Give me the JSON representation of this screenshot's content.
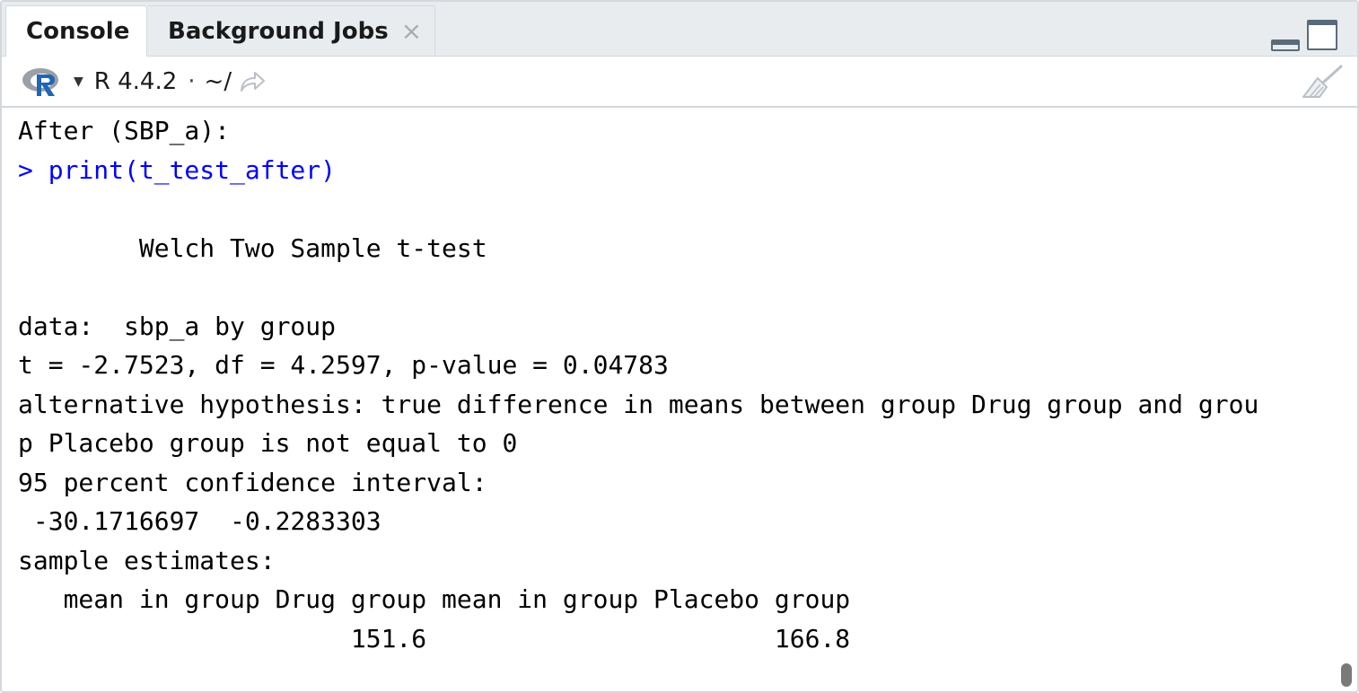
{
  "tabs": [
    {
      "label": "Console",
      "active": true
    },
    {
      "label": "Background Jobs",
      "active": false,
      "close_glyph": "×"
    }
  ],
  "toolbar": {
    "r_version": "R 4.4.2",
    "separator": "·",
    "working_dir": "~/",
    "icons": [
      "r-logo-icon",
      "dropdown-caret-icon",
      "go-to-directory-icon",
      "clear-console-broom-icon"
    ]
  },
  "console": {
    "lines": [
      {
        "text": "After (SBP_a):",
        "kind": "output"
      },
      {
        "text": "> print(t_test_after)",
        "kind": "command"
      },
      {
        "text": "",
        "kind": "output"
      },
      {
        "text": "        Welch Two Sample t-test",
        "kind": "output"
      },
      {
        "text": "",
        "kind": "output"
      },
      {
        "text": "data:  sbp_a by group",
        "kind": "output"
      },
      {
        "text": "t = -2.7523, df = 4.2597, p-value = 0.04783",
        "kind": "output"
      },
      {
        "text": "alternative hypothesis: true difference in means between group Drug group and grou",
        "kind": "output"
      },
      {
        "text": "p Placebo group is not equal to 0",
        "kind": "output"
      },
      {
        "text": "95 percent confidence interval:",
        "kind": "output"
      },
      {
        "text": " -30.1716697  -0.2283303",
        "kind": "output"
      },
      {
        "text": "sample estimates:",
        "kind": "output"
      },
      {
        "text": "   mean in group Drug group mean in group Placebo group",
        "kind": "output"
      },
      {
        "text": "                      151.6                       166.8",
        "kind": "output"
      }
    ],
    "command_color": "#0000ff",
    "output_color": "#000000"
  },
  "colors": {
    "tabbar_bg": "#e9ecef",
    "border": "#d4d8dd",
    "r_logo_blue": "#2165b6",
    "r_logo_grey": "#9aa0a6"
  }
}
